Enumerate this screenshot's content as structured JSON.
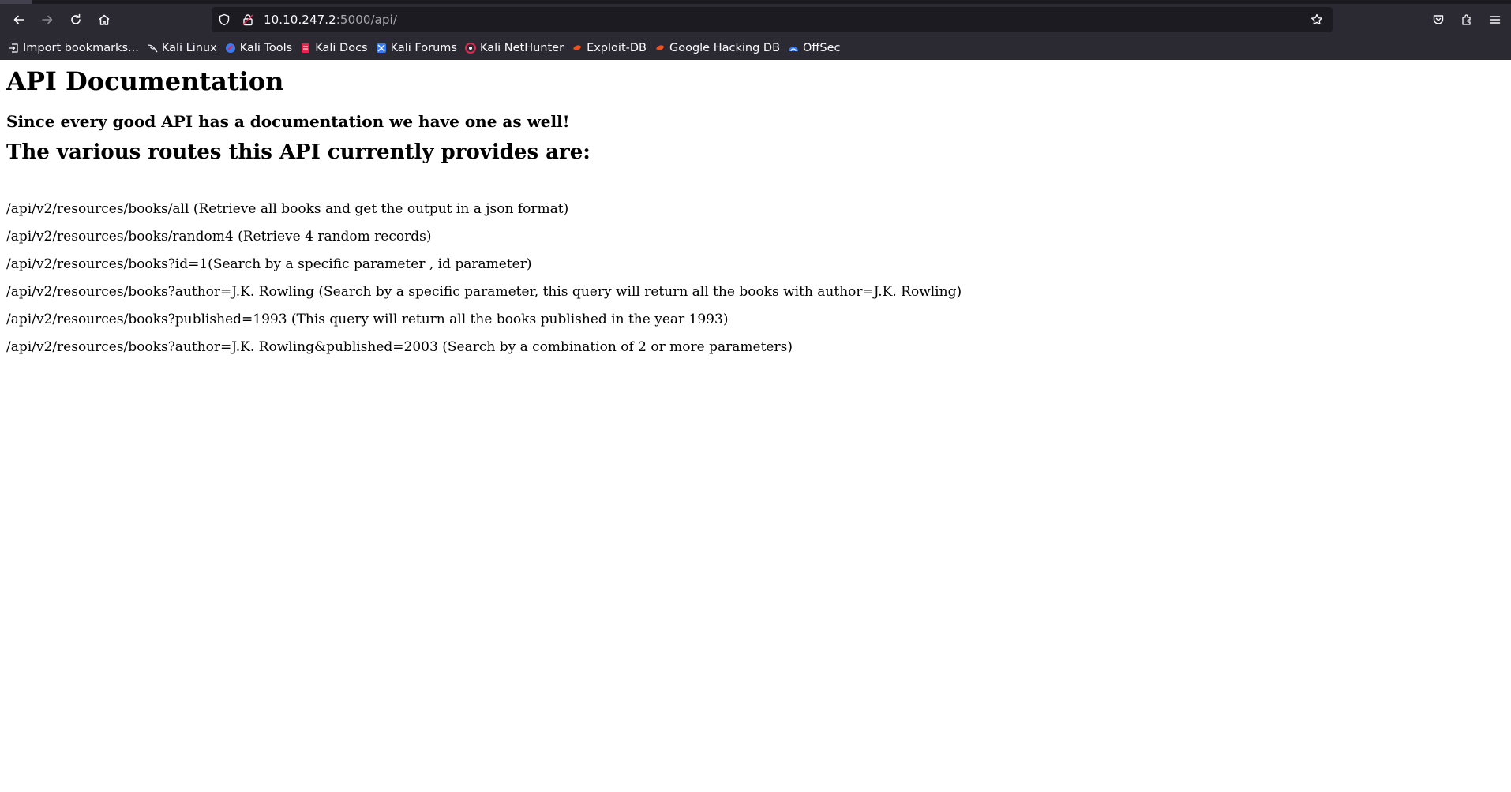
{
  "browser": {
    "url_host": "10.10.247.2",
    "url_rest": ":5000/api/",
    "bookmarks": [
      {
        "label": "Import bookmarks...",
        "icon": "import-icon"
      },
      {
        "label": "Kali Linux",
        "icon": "kali-dragon-icon"
      },
      {
        "label": "Kali Tools",
        "icon": "kali-tools-icon"
      },
      {
        "label": "Kali Docs",
        "icon": "kali-docs-icon"
      },
      {
        "label": "Kali Forums",
        "icon": "kali-forums-icon"
      },
      {
        "label": "Kali NetHunter",
        "icon": "nethunter-icon"
      },
      {
        "label": "Exploit-DB",
        "icon": "exploit-db-icon"
      },
      {
        "label": "Google Hacking DB",
        "icon": "ghdb-icon"
      },
      {
        "label": "OffSec",
        "icon": "offsec-icon"
      }
    ]
  },
  "page": {
    "title": "API Documentation",
    "subtitle": "Since every good API has a documentation we have one as well!",
    "routes_heading": "The various routes this API currently provides are:",
    "routes": [
      "/api/v2/resources/books/all (Retrieve all books and get the output in a json format)",
      "/api/v2/resources/books/random4 (Retrieve 4 random records)",
      "/api/v2/resources/books?id=1(Search by a specific parameter , id parameter)",
      "/api/v2/resources/books?author=J.K. Rowling (Search by a specific parameter, this query will return all the books with author=J.K. Rowling)",
      "/api/v2/resources/books?published=1993 (This query will return all the books published in the year 1993)",
      "/api/v2/resources/books?author=J.K. Rowling&published=2003 (Search by a combination of 2 or more parameters)"
    ]
  }
}
